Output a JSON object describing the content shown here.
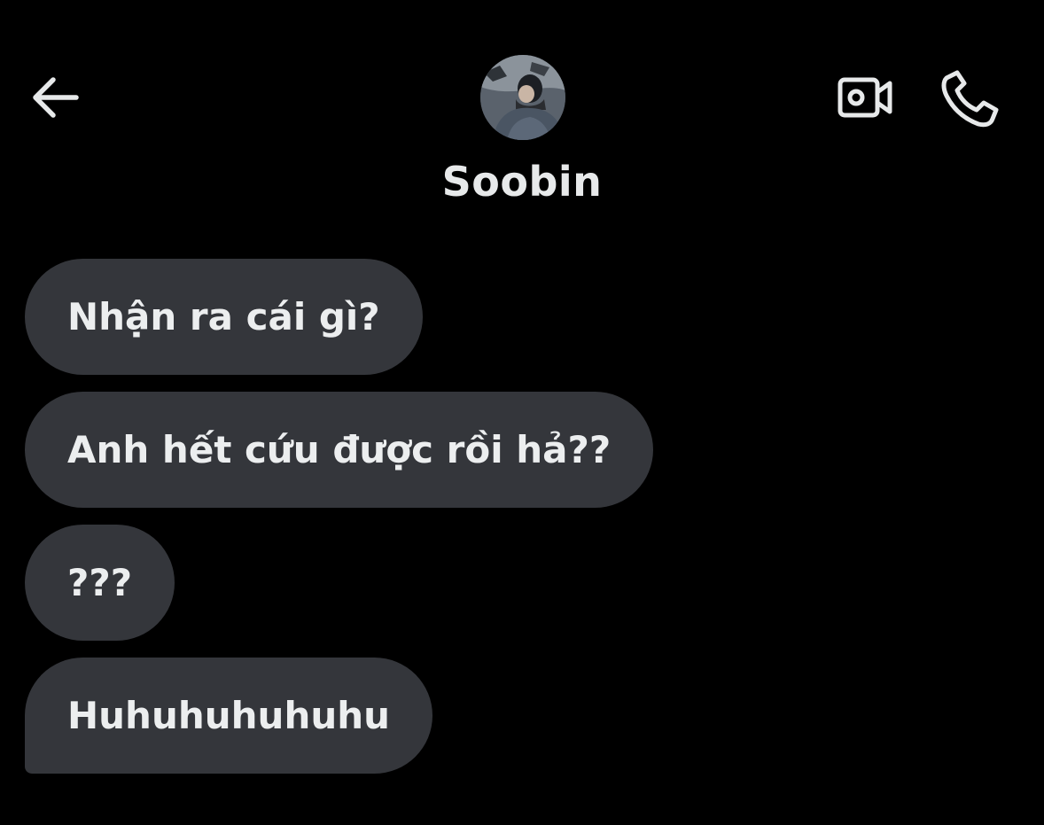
{
  "header": {
    "contact_name": "Soobin",
    "icons": {
      "back": "arrow-left-icon",
      "video": "video-camera-icon",
      "call": "phone-icon"
    }
  },
  "messages": [
    {
      "text": "Nhận ra cái gì?"
    },
    {
      "text": "Anh hết cứu được rồi hả??"
    },
    {
      "text": "???"
    },
    {
      "text": "Huhuhuhuhuhu"
    }
  ],
  "colors": {
    "background": "#000000",
    "bubble": "#34363b",
    "text": "#e7e9ea"
  }
}
